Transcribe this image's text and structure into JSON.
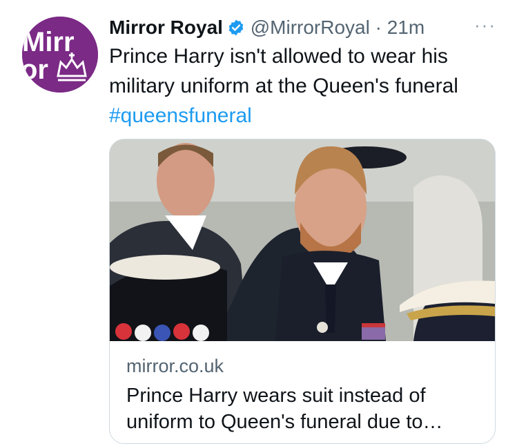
{
  "tweet": {
    "avatar_text_top": "Mirr",
    "avatar_text_bottom": "or",
    "display_name": "Mirror Royal",
    "handle": "@MirrorRoyal",
    "separator": "·",
    "time": "21m",
    "more": "···",
    "text": "Prince Harry isn't allowed to wear his military uniform at the Queen's funeral",
    "hashtag": "#queensfuneral"
  },
  "card": {
    "domain": "mirror.co.uk",
    "title": "Prince Harry wears suit instead of uniform to Queen's funeral due to…"
  },
  "colors": {
    "avatar": "#7b2a86",
    "verified": "#1d9bf0",
    "hashtag": "#1d9bf0",
    "muted": "#536471"
  },
  "icons": [
    "verified-badge-icon",
    "more-options-icon",
    "crown-icon"
  ]
}
